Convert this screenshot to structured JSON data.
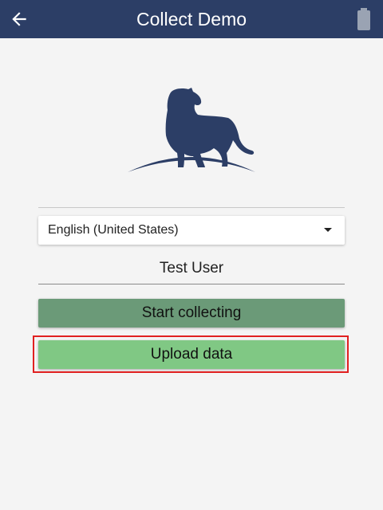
{
  "app_bar": {
    "title": "Collect Demo",
    "back_icon": "arrow-left-icon",
    "battery_icon": "battery-icon",
    "background": "#2c3e66"
  },
  "logo": {
    "icon": "jaguar-logo-icon",
    "color": "#2c3e66"
  },
  "language_select": {
    "value": "English (United States)",
    "icon": "dropdown-caret-icon"
  },
  "user": {
    "name": "Test User"
  },
  "buttons": {
    "start_label": "Start collecting",
    "start_color": "#6b9a78",
    "upload_label": "Upload data",
    "upload_color": "#80c884"
  },
  "highlight": {
    "target": "upload-data-button",
    "color": "#e02020"
  }
}
